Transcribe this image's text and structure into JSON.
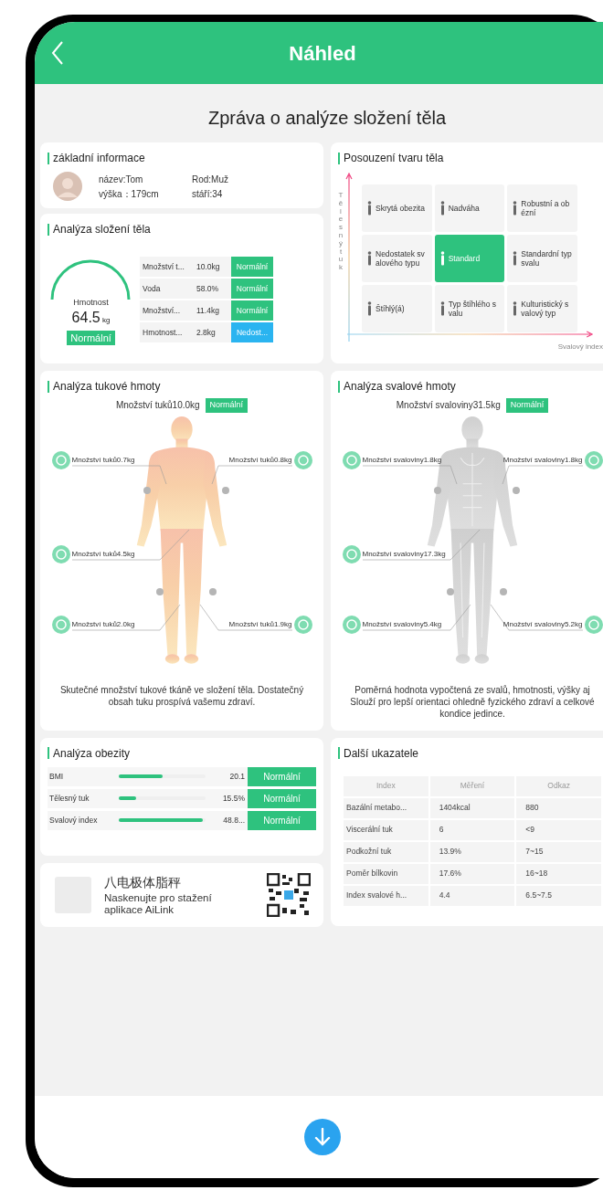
{
  "header": {
    "title": "Náhled"
  },
  "report_title": "Zpráva o analýze složení těla",
  "basic_info": {
    "title": "základní informace",
    "fields": [
      "název:Tom",
      "Rod:Muž",
      "výška：179cm",
      "stáří:34"
    ]
  },
  "composition": {
    "title": "Analýza složení těla",
    "gauge_label": "Hmotnost",
    "weight": "64.5",
    "unit": "kg",
    "status": "Normální",
    "rows": [
      {
        "name": "Množství t...",
        "value": "10.0kg",
        "status": "Normální",
        "kind": "normal"
      },
      {
        "name": "Voda",
        "value": "58.0%",
        "status": "Normální",
        "kind": "normal"
      },
      {
        "name": "Množství...",
        "value": "11.4kg",
        "status": "Normální",
        "kind": "normal"
      },
      {
        "name": "Hmotnost...",
        "value": "2.8kg",
        "status": "Nedost...",
        "kind": "low"
      }
    ]
  },
  "body_shape": {
    "title": "Posouzení tvaru těla",
    "y_axis": "Tělesný tuk",
    "x_axis": "Svalový index",
    "cells": [
      {
        "label": "Skrytá obezita",
        "selected": false
      },
      {
        "label": "Nadváha",
        "selected": false
      },
      {
        "label": "Robustní a obézní",
        "selected": false
      },
      {
        "label": "Nedostatek svalového typu",
        "selected": false
      },
      {
        "label": "Standard",
        "selected": true
      },
      {
        "label": "Standardní typ svalu",
        "selected": false
      },
      {
        "label": "Štíhlý(á)",
        "selected": false
      },
      {
        "label": "Typ štíhlého svalu",
        "selected": false
      },
      {
        "label": "Kulturistický svalový typ",
        "selected": false
      }
    ]
  },
  "fat_analysis": {
    "title": "Analýza tukové hmoty",
    "total": "Množství tuků10.0kg",
    "status": "Normální",
    "regions": [
      "Množství tuků0.7kg",
      "Množství tuků0.8kg",
      "Množství tuků4.5kg",
      "Množství tuků2.0kg",
      "Množství tuků1.9kg"
    ],
    "note": "Skutečné množství tukové tkáně ve složení těla. Dostatečný obsah tuku prospívá vašemu zdraví."
  },
  "muscle_analysis": {
    "title": "Analýza svalové hmoty",
    "total": "Množství svaloviny31.5kg",
    "status": "Normální",
    "regions": [
      "Množství svaloviny1.8kg",
      "Množství svaloviny1.8kg",
      "Množství svaloviny17.3kg",
      "Množství svaloviny5.4kg",
      "Množství svaloviny5.2kg"
    ],
    "note": "Poměrná hodnota vypočtená ze svalů, hmotnosti, výšky aj Slouží pro lepší orientaci ohledně fyzického zdraví a celkové kondice jedince."
  },
  "obesity": {
    "title": "Analýza obezity",
    "rows": [
      {
        "name": "BMI",
        "level": 0.5,
        "value": "20.1",
        "status": "Normální"
      },
      {
        "name": "Tělesný tuk",
        "level": 0.2,
        "value": "15.5%",
        "status": "Normální"
      },
      {
        "name": "Svalový index",
        "level": 0.97,
        "value": "48.8...",
        "status": "Normální"
      }
    ]
  },
  "app_promo": {
    "product": "八电极体脂秤",
    "text": "Naskenujte pro stažení aplikace AiLink"
  },
  "indicators": {
    "title": "Další ukazatele",
    "columns": [
      "Index",
      "Měření",
      "Odkaz"
    ],
    "rows": [
      [
        "Bazální metabo...",
        "1404kcal",
        "880"
      ],
      [
        "Viscerální tuk",
        "6",
        "<9"
      ],
      [
        "Podkožní tuk",
        "13.9%",
        "7~15"
      ],
      [
        "Poměr bílkovin",
        "17.6%",
        "16~18"
      ],
      [
        "Index svalové h...",
        "4.4",
        "6.5~7.5"
      ]
    ]
  }
}
